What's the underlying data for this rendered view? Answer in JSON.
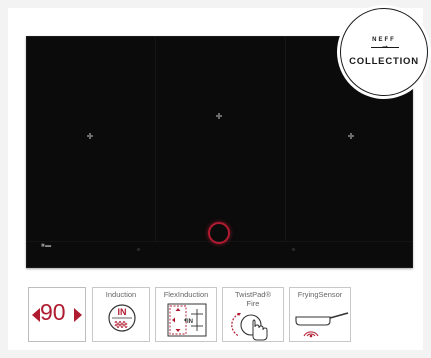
{
  "product": {
    "badge_brand": "NEFF",
    "badge_collection": "COLLECTION"
  },
  "features": [
    {
      "label": "",
      "value": "90"
    },
    {
      "label": "Induction",
      "icon_text": "IN"
    },
    {
      "label": "FlexInduction",
      "icon_text": "IN"
    },
    {
      "label": "TwistPad®\nFire"
    },
    {
      "label": "FryingSensor"
    }
  ],
  "colors": {
    "accent": "#b01b30",
    "hob_glass": "#0b0b0b",
    "border": "#c8c8c8"
  },
  "icons": [
    "size-arrow-left-icon",
    "size-arrow-right-icon",
    "induction-icon",
    "flexinduction-icon",
    "twistpad-fire-icon",
    "frying-sensor-icon"
  ]
}
